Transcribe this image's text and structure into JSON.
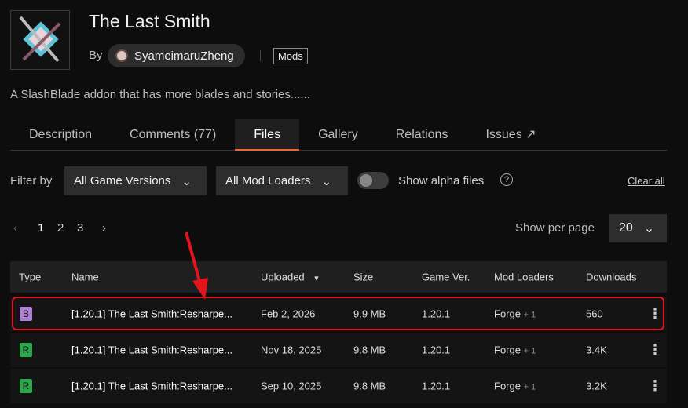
{
  "project": {
    "title": "The Last Smith",
    "by_label": "By",
    "author": "SyameimaruZheng",
    "category": "Mods",
    "description": "A SlashBlade addon that has more blades and stories......"
  },
  "tabs": [
    {
      "label": "Description"
    },
    {
      "label": "Comments (77)"
    },
    {
      "label": "Files"
    },
    {
      "label": "Gallery"
    },
    {
      "label": "Relations"
    },
    {
      "label": "Issues"
    }
  ],
  "filters": {
    "label": "Filter by",
    "game_versions": "All Game Versions",
    "mod_loaders": "All Mod Loaders",
    "show_alpha": "Show alpha files",
    "help": "?",
    "clear": "Clear all"
  },
  "pagination": {
    "prev": "‹",
    "pages": [
      "1",
      "2",
      "3"
    ],
    "next": "›",
    "per_page_label": "Show per page",
    "per_page": "20"
  },
  "table": {
    "headers": [
      "Type",
      "Name",
      "Uploaded",
      "Size",
      "Game Ver.",
      "Mod Loaders",
      "Downloads"
    ],
    "rows": [
      {
        "type": "B",
        "type_color": "#b07fd8",
        "name": "[1.20.1] The Last Smith:Resharpe...",
        "uploaded": "Feb 2, 2026",
        "size": "9.9 MB",
        "game": "1.20.1",
        "loader": "Forge",
        "loader_extra": "+ 1",
        "downloads": "560"
      },
      {
        "type": "R",
        "type_color": "#2aa84a",
        "name": "[1.20.1] The Last Smith:Resharpe...",
        "uploaded": "Nov 18, 2025",
        "size": "9.8 MB",
        "game": "1.20.1",
        "loader": "Forge",
        "loader_extra": "+ 1",
        "downloads": "3.4K"
      },
      {
        "type": "R",
        "type_color": "#2aa84a",
        "name": "[1.20.1] The Last Smith:Resharpe...",
        "uploaded": "Sep 10, 2025",
        "size": "9.8 MB",
        "game": "1.20.1",
        "loader": "Forge",
        "loader_extra": "+ 1",
        "downloads": "3.2K"
      }
    ]
  },
  "colors": {
    "accent": "#f16436",
    "highlight": "#e3141b"
  }
}
